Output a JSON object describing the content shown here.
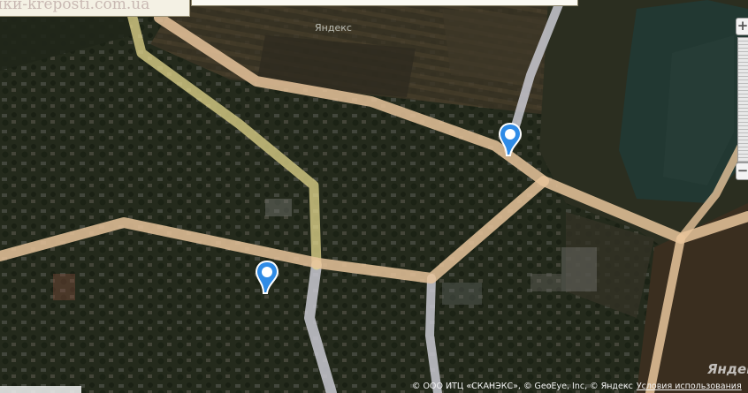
{
  "header": {
    "site_text": "ики-kreposti.com.ua",
    "map_watermark": "Яндекс"
  },
  "zoom_controls": {
    "zoom_in_label": "+",
    "zoom_out_label": "−"
  },
  "markers": [
    {
      "name": "map-marker-north",
      "icon": "pin-icon"
    },
    {
      "name": "map-marker-south",
      "icon": "pin-icon"
    }
  ],
  "footer": {
    "logo": "Яндекс",
    "copyright": "© ООО ИТЦ «СКАНЭКС», © GeoEye, Inc, © Яндекс",
    "terms_link": "Условия использования"
  },
  "colors": {
    "main_road": "#e8c49b",
    "highway": "#e6d98e",
    "minor_road": "#c9c9d1",
    "marker": "#2f8be6",
    "water": "#223832"
  }
}
